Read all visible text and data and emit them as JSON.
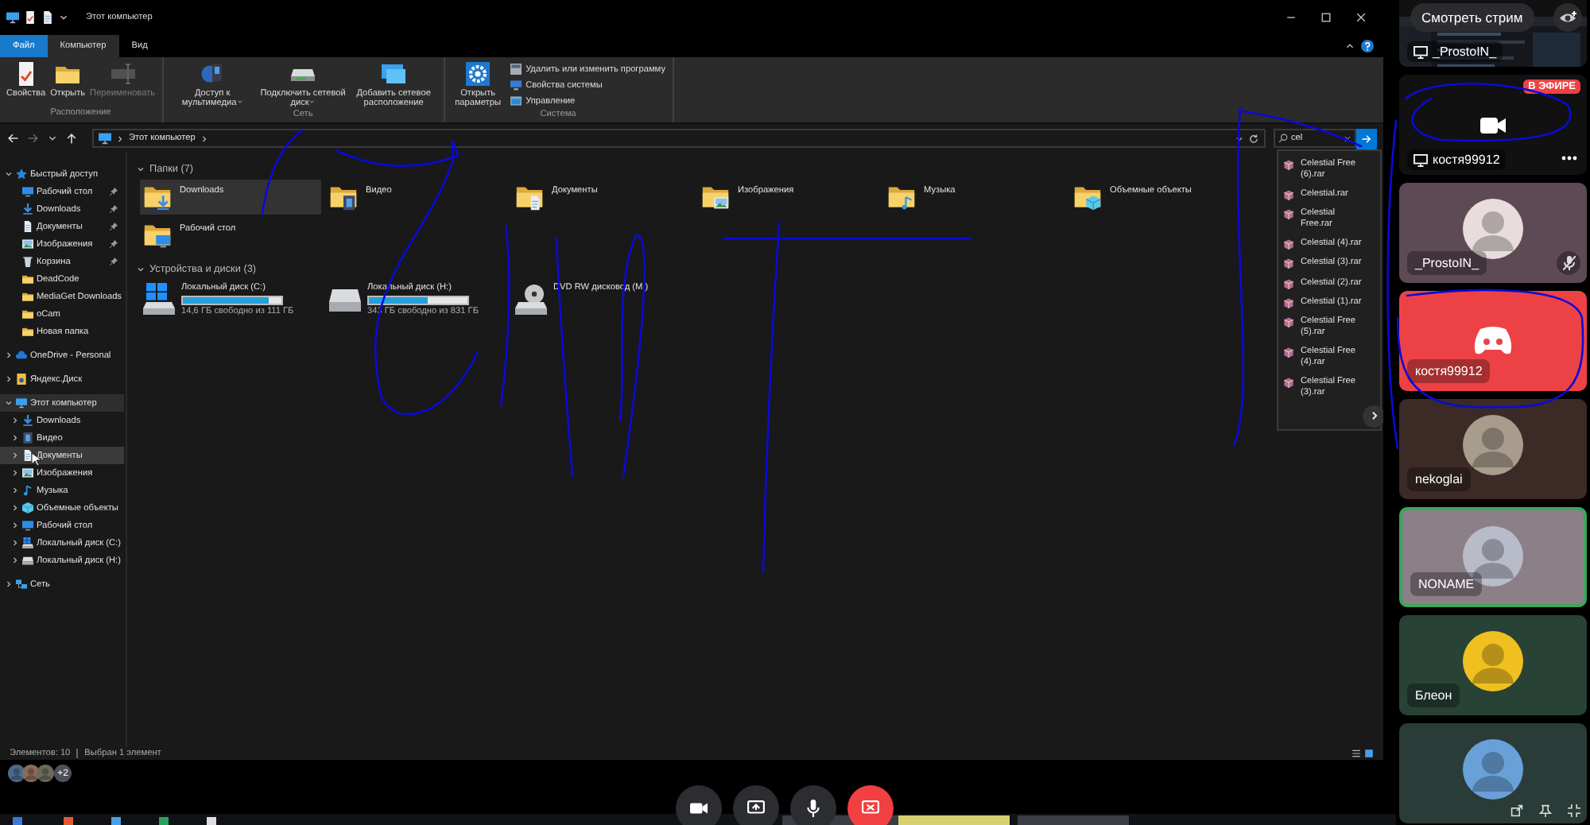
{
  "explorer": {
    "title": "Этот компьютер",
    "tabs": [
      {
        "label": "Файл",
        "kind": "file",
        "selected": false
      },
      {
        "label": "Компьютер",
        "kind": "tab",
        "selected": true
      },
      {
        "label": "Вид",
        "kind": "tab",
        "selected": false
      }
    ],
    "ribbon": [
      {
        "label": "Расположение",
        "buttons": [
          {
            "label": "Свойства",
            "kind": "props",
            "disabled": false
          },
          {
            "label": "Открыть",
            "kind": "open",
            "disabled": false
          },
          {
            "label": "Переименовать",
            "kind": "rename",
            "disabled": true
          }
        ]
      },
      {
        "label": "Сеть",
        "buttons": [
          {
            "label": "Доступ к мультимедиа",
            "kind": "media",
            "disabled": false,
            "dropdown": true
          },
          {
            "label": "Подключить сетевой диск",
            "kind": "mapdrive",
            "disabled": false,
            "dropdown": true
          },
          {
            "label": "Добавить сетевое расположение",
            "kind": "addloc",
            "disabled": false
          }
        ]
      },
      {
        "label": "Система",
        "buttons": [
          {
            "label": "Открыть параметры",
            "kind": "settings",
            "disabled": false
          }
        ],
        "links": [
          {
            "label": "Удалить или изменить программу",
            "kind": "uninstall"
          },
          {
            "label": "Свойства системы",
            "kind": "sysprops"
          },
          {
            "label": "Управление",
            "kind": "manage"
          }
        ]
      }
    ],
    "address": [
      "Этот компьютер"
    ],
    "search": {
      "value": "cel"
    },
    "suggestions": [
      "Celestial Free (6).rar",
      "Celestial.rar",
      "Celestial Free.rar",
      "Celestial (4).rar",
      "Celestial (3).rar",
      "Celestial (2).rar",
      "Celestial (1).rar",
      "Celestial Free (5).rar",
      "Celestial Free (4).rar",
      "Celestial Free (3).rar"
    ],
    "nav": [
      {
        "label": "Быстрый доступ",
        "kind": "star",
        "expanded": true,
        "selected": false,
        "children": [
          {
            "label": "Рабочий стол",
            "kind": "desktop",
            "pinned": true,
            "selected": false
          },
          {
            "label": "Downloads",
            "kind": "download",
            "pinned": true,
            "selected": false
          },
          {
            "label": "Документы",
            "kind": "docs",
            "pinned": true,
            "selected": false
          },
          {
            "label": "Изображения",
            "kind": "pictures",
            "pinned": true,
            "selected": false
          },
          {
            "label": "Корзина",
            "kind": "trash",
            "pinned": true,
            "selected": false
          },
          {
            "label": "DeadCode",
            "kind": "folder",
            "pinned": false,
            "selected": false
          },
          {
            "label": "MediaGet Downloads",
            "kind": "folder",
            "pinned": false,
            "selected": false
          },
          {
            "label": "oCam",
            "kind": "folder",
            "pinned": false,
            "selected": false
          },
          {
            "label": "Новая папка",
            "kind": "folder",
            "pinned": false,
            "selected": false
          }
        ]
      },
      {
        "label": "OneDrive - Personal",
        "kind": "cloud",
        "expanded": false,
        "selected": false
      },
      {
        "label": "Яндекс.Диск",
        "kind": "yadisk",
        "expanded": false,
        "selected": false
      },
      {
        "label": "Этот компьютер",
        "kind": "pc",
        "expanded": true,
        "selected": true,
        "children": [
          {
            "label": "Downloads",
            "kind": "download",
            "expanded": false,
            "selected": false
          },
          {
            "label": "Видео",
            "kind": "video",
            "expanded": false,
            "selected": false
          },
          {
            "label": "Документы",
            "kind": "docs",
            "expanded": false,
            "selected": false,
            "hovered": true
          },
          {
            "label": "Изображения",
            "kind": "pictures",
            "expanded": false,
            "selected": false
          },
          {
            "label": "Музыка",
            "kind": "music",
            "expanded": false,
            "selected": false
          },
          {
            "label": "Объемные объекты",
            "kind": "cube",
            "expanded": false,
            "selected": false
          },
          {
            "label": "Рабочий стол",
            "kind": "desktop",
            "expanded": false,
            "selected": false
          },
          {
            "label": "Локальный диск (C:)",
            "kind": "sysdrive",
            "expanded": false,
            "selected": false
          },
          {
            "label": "Локальный диск (H:)",
            "kind": "drive",
            "expanded": false,
            "selected": false
          }
        ]
      },
      {
        "label": "Сеть",
        "kind": "network",
        "expanded": false,
        "selected": false
      }
    ],
    "sections": [
      {
        "title": "Папки (7)",
        "kind": "folders",
        "expanded": true,
        "items": [
          {
            "label": "Downloads",
            "kind": "download",
            "selected": true
          },
          {
            "label": "Видео",
            "kind": "video",
            "selected": false
          },
          {
            "label": "Документы",
            "kind": "docs",
            "selected": false
          },
          {
            "label": "Изображения",
            "kind": "pictures",
            "selected": false
          },
          {
            "label": "Музыка",
            "kind": "music",
            "selected": false
          },
          {
            "label": "Объемные объекты",
            "kind": "cube",
            "selected": false
          },
          {
            "label": "Рабочий стол",
            "kind": "desktop",
            "selected": false
          }
        ]
      },
      {
        "title": "Устройства и диски (3)",
        "kind": "drives",
        "expanded": true,
        "items": [
          {
            "label": "Локальный диск (C:)",
            "kind": "sysdrive",
            "level": 0.87,
            "free": "14,6 ГБ свободно из 111 ГБ"
          },
          {
            "label": "Локальный диск (H:)",
            "kind": "drive",
            "level": 0.59,
            "free": "343 ГБ свободно из 831 ГБ"
          },
          {
            "label": "DVD RW дисковод (M:)",
            "kind": "dvd"
          }
        ]
      }
    ],
    "status": [
      "Элементов: 10",
      "Выбран 1 элемент"
    ]
  },
  "call": {
    "tiles": [
      {
        "kind": "stream",
        "name": "_ProstoIN_",
        "preview": true,
        "button": "Смотреть стрим",
        "more_menu": false
      },
      {
        "kind": "stream",
        "name": "костя99912",
        "preview": false,
        "badge": "В ЭФИРЕ",
        "more_menu": true
      },
      {
        "kind": "user",
        "name": "_ProstoIN_",
        "color": "#5e4a55",
        "avatar": {
          "color": "#e8dcdc"
        },
        "muted": true,
        "speaking": false
      },
      {
        "kind": "default",
        "name": "костя99912",
        "color": "#ed4245",
        "muted": false,
        "speaking": false
      },
      {
        "kind": "user",
        "name": "nekoglai",
        "color": "#3b2a25",
        "avatar": {
          "color": "#a89c8c"
        },
        "muted": false,
        "speaking": false
      },
      {
        "kind": "user",
        "name": "NONAME",
        "color": "#8b7f88",
        "avatar": {
          "color": "#b8bcc8"
        },
        "muted": false,
        "speaking": true
      },
      {
        "kind": "user",
        "name": "Блеон",
        "color": "#284236",
        "avatar": {
          "color": "#f0c020"
        },
        "muted": false,
        "speaking": false
      },
      {
        "kind": "user",
        "color": "#2a3c38",
        "avatar": {
          "color": "#6aa0d8"
        },
        "muted": false,
        "speaking": false
      }
    ],
    "participants": [
      {
        "color": "#4a6a8a"
      },
      {
        "color": "#8a6a5a"
      },
      {
        "color": "#6a6a5a"
      }
    ],
    "more_participants": "+2",
    "controls": [
      {
        "kind": "camera"
      },
      {
        "kind": "share"
      },
      {
        "kind": "mic"
      },
      {
        "kind": "leave"
      }
    ]
  }
}
